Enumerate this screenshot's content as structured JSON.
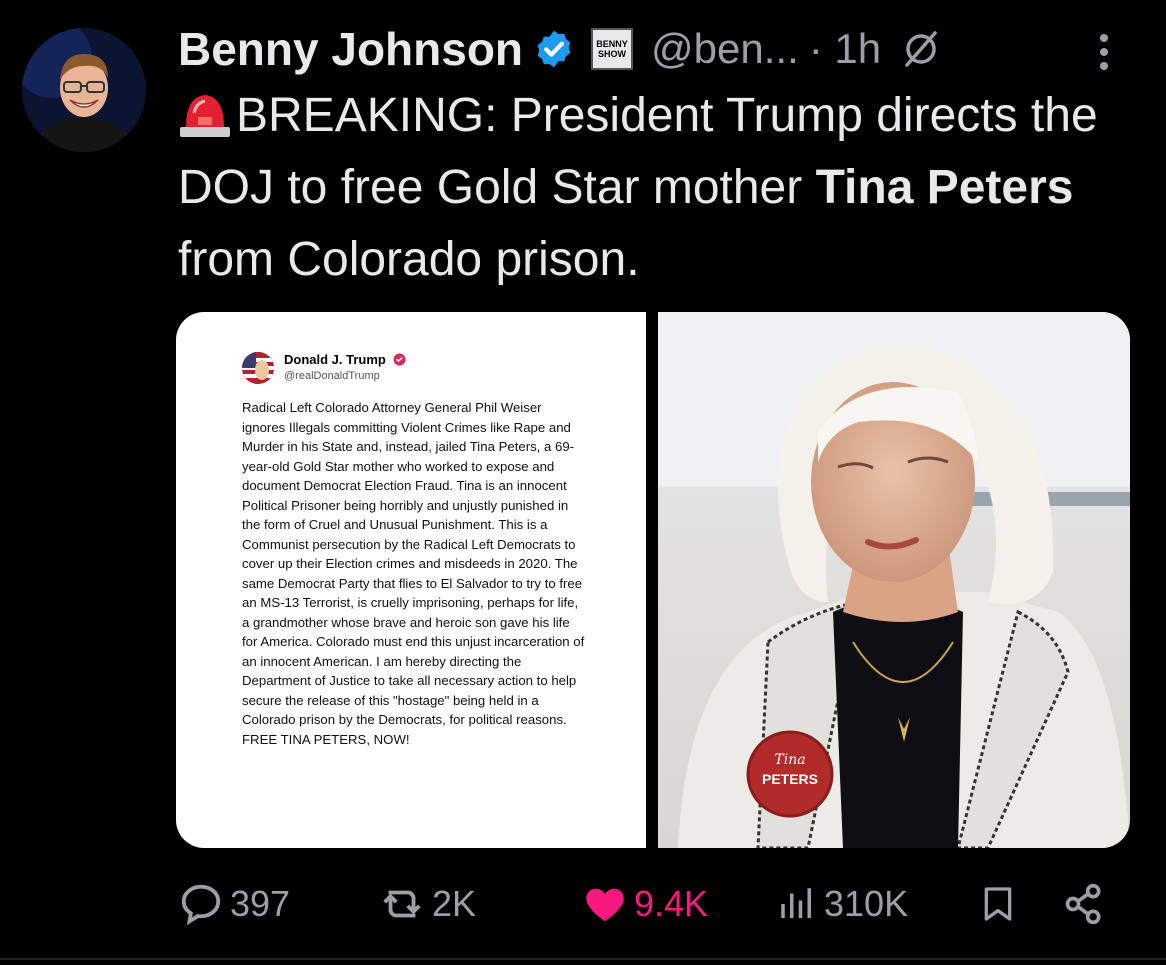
{
  "tweet": {
    "author_name": "Benny Johnson",
    "handle": "@ben...",
    "time": "· 1h",
    "text_part1": "BREAKING: President Trump directs the DOJ to free Gold Star mother ",
    "text_bold1": "Tina Peters",
    "text_part2": " from Colorado prison."
  },
  "show_logo": {
    "line1": "BENNY",
    "line2": "SHOW"
  },
  "embedded_post": {
    "name": "Donald J. Trump",
    "handle": "@realDonaldTrump",
    "body": "Radical Left Colorado Attorney General Phil Weiser ignores Illegals committing Violent Crimes like Rape and Murder in his State and, instead, jailed Tina Peters, a 69-year-old Gold Star mother who worked to expose and document Democrat Election Fraud. Tina is an innocent Political Prisoner being horribly and unjustly punished in the form of Cruel and Unusual Punishment. This is a Communist persecution by the Radical Left Democrats to cover up their Election crimes and misdeeds in 2020. The same Democrat Party that flies to El Salvador to try to free an MS-13 Terrorist, is cruelly imprisoning, perhaps for life, a grandmother whose brave and heroic son gave his life for America. Colorado must end this unjust incarceration of an innocent American. I am hereby directing the Department of Justice to take all necessary action to help secure the release of this \"hostage\" being held in a Colorado prison by the Democrats, for political reasons. FREE TINA PETERS, NOW!"
  },
  "photo": {
    "button_line1": "Tina",
    "button_line2": "PETERS"
  },
  "actions": {
    "replies": "397",
    "reposts": "2K",
    "likes": "9.4K",
    "views": "310K"
  },
  "colors": {
    "like": "#f91880",
    "verified": "#1d9bf0",
    "muted": "#9aa0a6",
    "background": "#000000"
  }
}
